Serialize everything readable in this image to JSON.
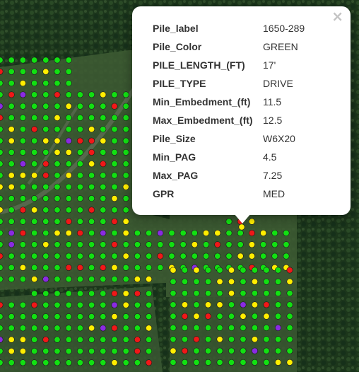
{
  "popup": {
    "close_label": "×",
    "rows": [
      {
        "key": "Pile_label",
        "value": "1650-289"
      },
      {
        "key": "Pile_Color",
        "value": "GREEN"
      },
      {
        "key": "PILE_LENGTH_(FT)",
        "value": "17'"
      },
      {
        "key": "PILE_TYPE",
        "value": "DRIVE"
      },
      {
        "key": "Min_Embedment_(ft)",
        "value": "11.5"
      },
      {
        "key": "Max_Embedment_(ft)",
        "value": "12.5"
      },
      {
        "key": "Pile_Size",
        "value": "W6X20"
      },
      {
        "key": "Min_PAG",
        "value": "4.5"
      },
      {
        "key": "Max_PAG",
        "value": "7.25"
      },
      {
        "key": "GPR",
        "value": "MED"
      }
    ]
  },
  "map": {
    "marker_colors": {
      "green": "#12e012",
      "yellow": "#ffee00",
      "red": "#f01818",
      "purple": "#8a2be2"
    },
    "forest_color": "#1e3a1c",
    "clearing_color": "#3b5a32"
  }
}
